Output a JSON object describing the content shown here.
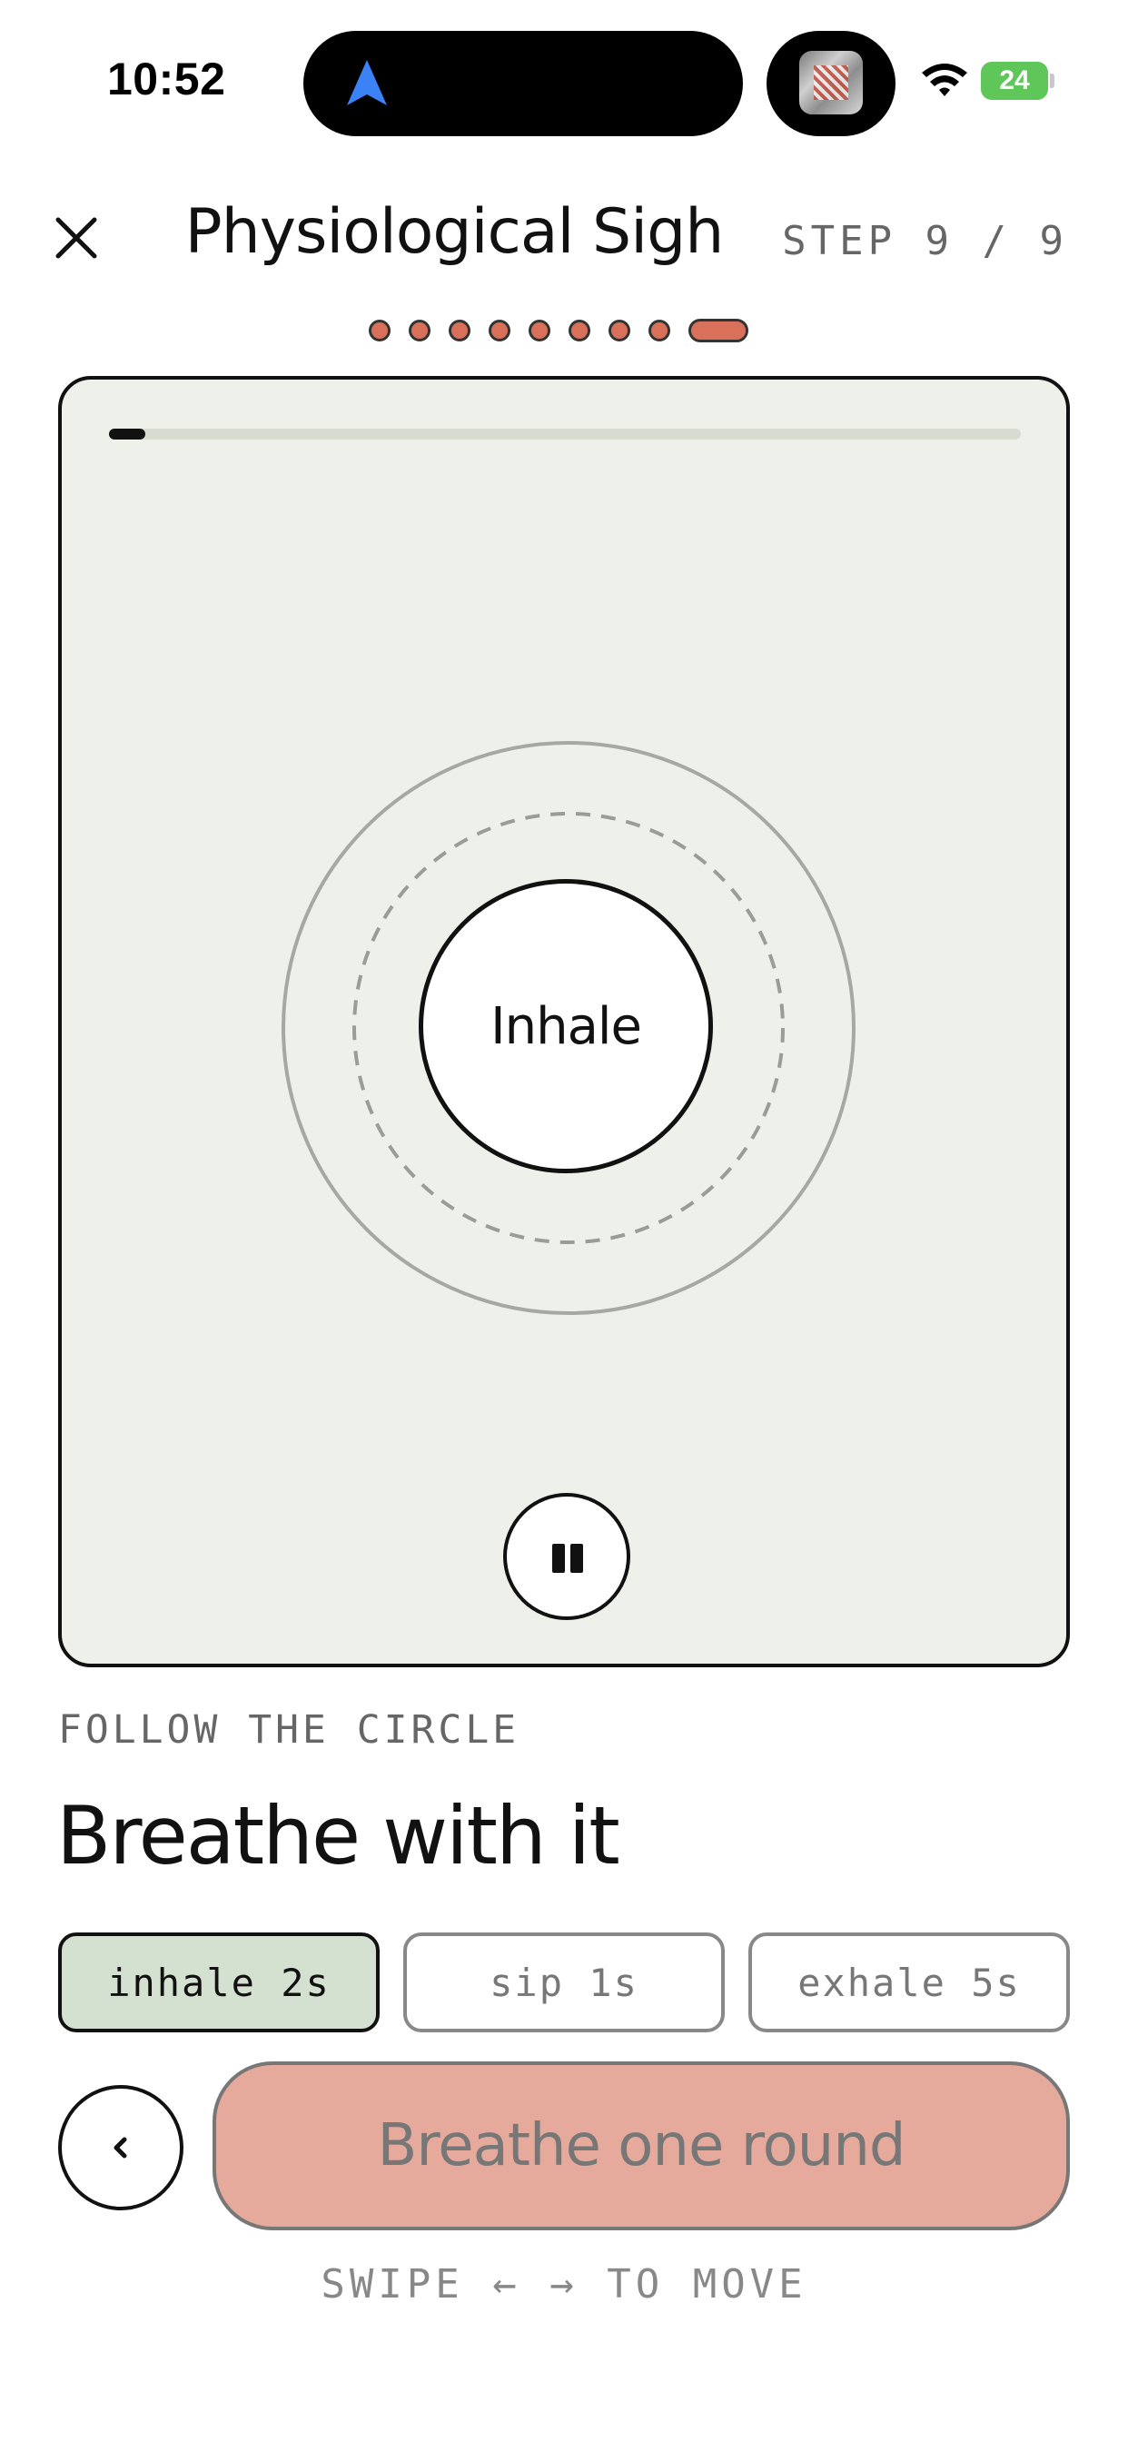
{
  "status_bar": {
    "time": "10:52",
    "battery": "24",
    "battery_color": "#5fc65a",
    "icons": [
      "navigation-arrow-icon",
      "wifi-icon",
      "battery-charging-icon"
    ]
  },
  "header": {
    "title": "Physiological Sigh",
    "step": "STEP 9 / 9",
    "close_icon": "close-icon"
  },
  "progress_dots": {
    "total": 9,
    "current": 9,
    "accent": "#d9705a"
  },
  "exercise": {
    "progress": 0.04,
    "phase": "Inhale",
    "pause_icon": "pause-icon"
  },
  "content": {
    "eyebrow": "FOLLOW THE CIRCLE",
    "heading": "Breathe with it"
  },
  "phases": [
    {
      "label": "inhale 2s",
      "active": true
    },
    {
      "label": "sip 1s",
      "active": false
    },
    {
      "label": "exhale 5s",
      "active": false
    }
  ],
  "actions": {
    "back_icon": "chevron-left-icon",
    "primary_label": "Breathe one round",
    "primary_color": "#e5aa9c"
  },
  "footer": {
    "hint": "SWIPE ← → TO MOVE"
  }
}
